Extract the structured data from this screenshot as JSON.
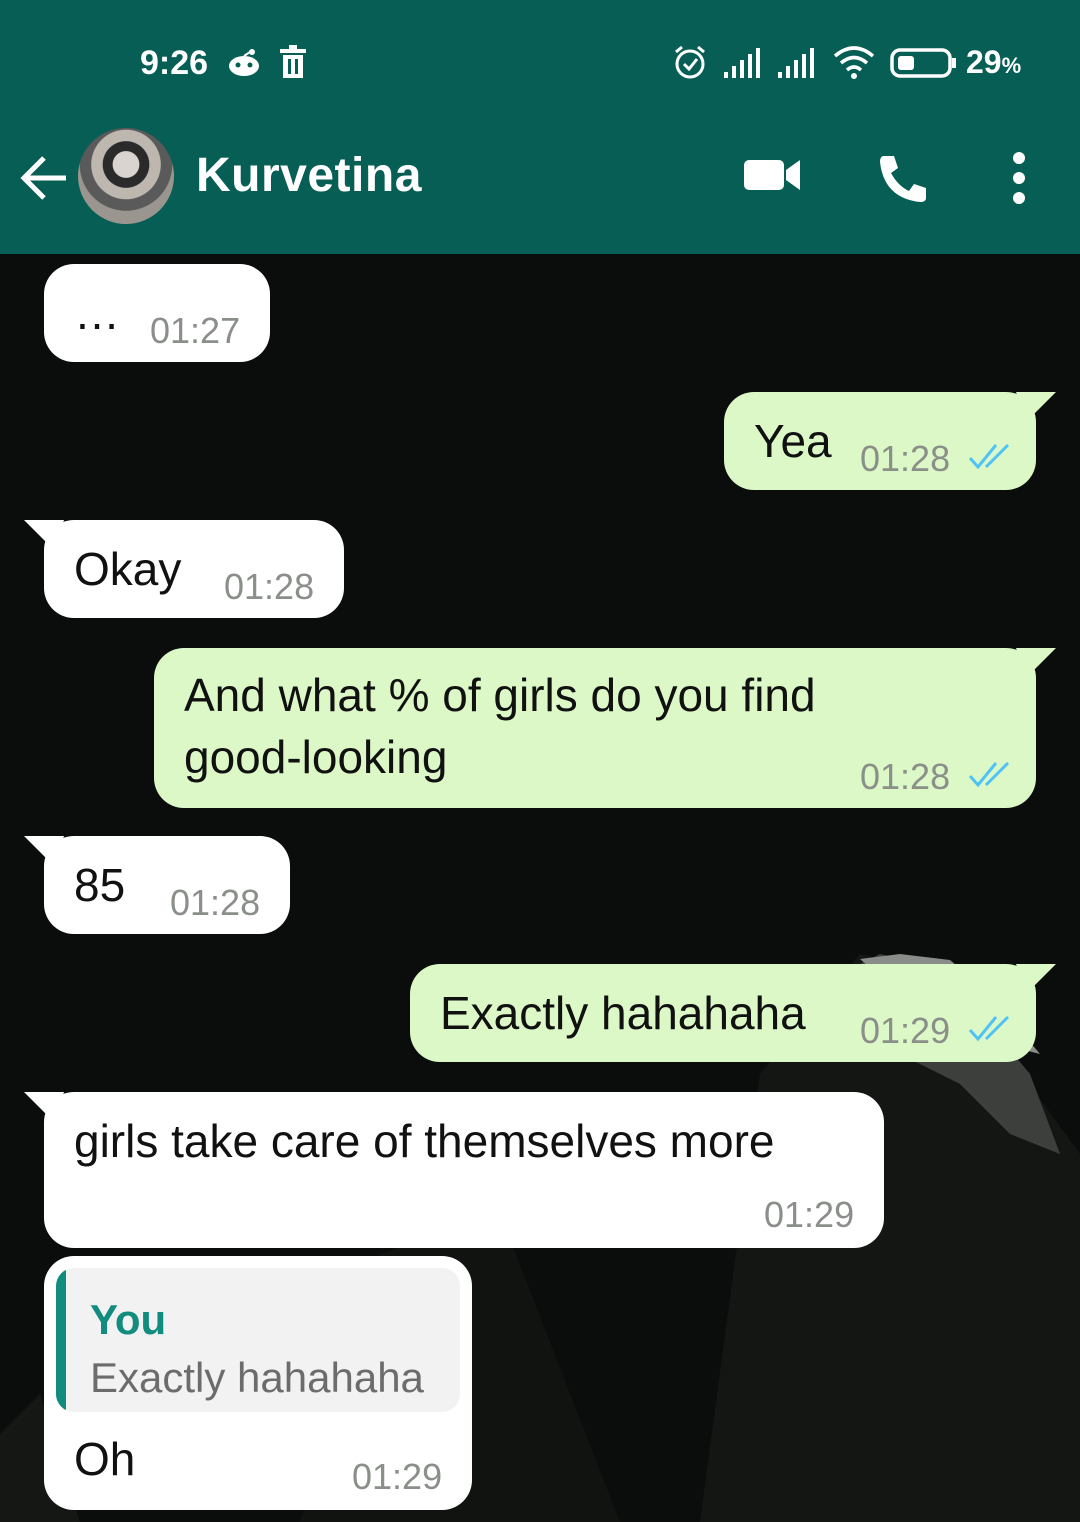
{
  "status_bar": {
    "time": "9:26",
    "battery_percent": "29",
    "battery_unit": "%",
    "icons": [
      "reddit-icon",
      "trash-icon",
      "alarm-icon",
      "signal-icon",
      "signal-icon",
      "wifi-icon",
      "battery-icon"
    ]
  },
  "header": {
    "contact_name": "Kurvetina",
    "icons": [
      "back-arrow-icon",
      "video-call-icon",
      "phone-icon",
      "more-options-icon"
    ],
    "color": "#075e54"
  },
  "colors": {
    "incoming_bubble": "#ffffff",
    "outgoing_bubble": "#dcf8c6",
    "read_ticks": "#4fc3f7",
    "quote_accent": "#128c7e"
  },
  "messages": [
    {
      "direction": "in",
      "text": "…",
      "time": "01:27"
    },
    {
      "direction": "out",
      "text": "Yea",
      "time": "01:28",
      "status": "read"
    },
    {
      "direction": "in",
      "text": "Okay",
      "time": "01:28"
    },
    {
      "direction": "out",
      "text": "And what % of girls do you find good-looking",
      "time": "01:28",
      "status": "read"
    },
    {
      "direction": "in",
      "text": "85",
      "time": "01:28"
    },
    {
      "direction": "out",
      "text": "Exactly hahahaha",
      "time": "01:29",
      "status": "read"
    },
    {
      "direction": "in",
      "text": "girls take care of themselves more",
      "time": "01:29"
    },
    {
      "direction": "in",
      "text": "Oh",
      "time": "01:29",
      "reply_to": {
        "author": "You",
        "text": "Exactly hahahaha"
      }
    }
  ]
}
